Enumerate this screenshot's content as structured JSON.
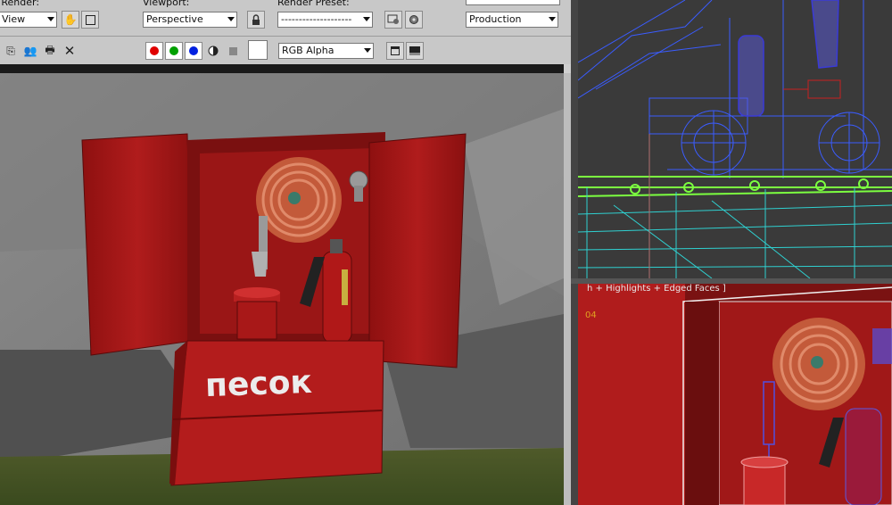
{
  "render_frame": {
    "area_label": "Area to Render:",
    "area_value": "View",
    "viewport_label": "Viewport:",
    "viewport_value": "Perspective",
    "preset_label": "Render Preset:",
    "preset_value": "--------------------",
    "production_value": "Production",
    "channel_value": "RGB Alpha"
  },
  "scene": {
    "sand_box_text": "песок"
  },
  "viewports": {
    "bottom_label": "h + Highlights + Edged Faces ]",
    "bottom_number": "04"
  },
  "colors": {
    "cabinet_red": "#a81818",
    "wall_grey": "#9a9a9a",
    "wire_blue": "#3a5cff",
    "wire_green": "#7cff40",
    "wire_cyan": "#2fd0d0",
    "toolbar_bg": "#c8c8c8"
  }
}
